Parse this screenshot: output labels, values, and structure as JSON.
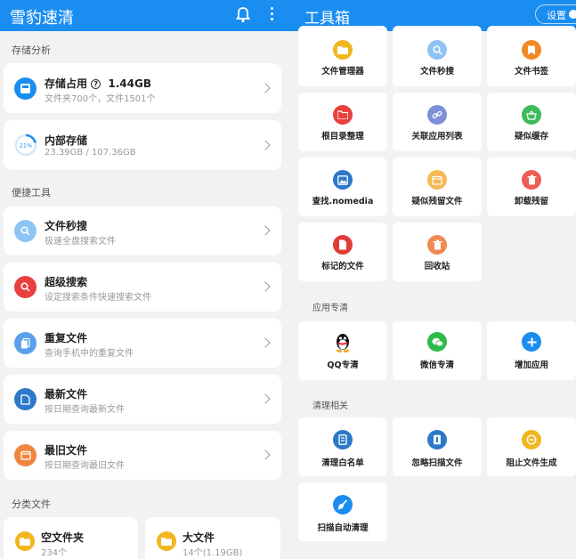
{
  "left_header": {
    "title": "雪豹速清"
  },
  "storage_section": {
    "label": "存储分析"
  },
  "storage_usage": {
    "title": "存储占用",
    "value": "1.44GB",
    "subtitle": "文件夹700个，文件1501个"
  },
  "internal_storage": {
    "title": "内部存储",
    "subtitle": "23.39GB / 107.36GB",
    "percent_label": "21%",
    "percent": 21
  },
  "tools_section": {
    "label": "便捷工具"
  },
  "tools": [
    {
      "title": "文件秒搜",
      "subtitle": "极速全盘搜索文件",
      "icon": "search-icon",
      "color": "#8ec4f3"
    },
    {
      "title": "超级搜索",
      "subtitle": "设定搜索条件快速搜索文件",
      "icon": "search-plus-icon",
      "color": "#e8403f"
    },
    {
      "title": "重复文件",
      "subtitle": "查询手机中的重复文件",
      "icon": "duplicate-file-icon",
      "color": "#5aa0ea"
    },
    {
      "title": "最新文件",
      "subtitle": "按日期查询最新文件",
      "icon": "new-file-icon",
      "color": "#2d79c9"
    },
    {
      "title": "最旧文件",
      "subtitle": "按日期查询最旧文件",
      "icon": "old-file-icon",
      "color": "#ef8640"
    }
  ],
  "category_section": {
    "label": "分类文件"
  },
  "categories": [
    {
      "title": "空文件夹",
      "subtitle": "234个",
      "icon": "folder-icon"
    },
    {
      "title": "大文件",
      "subtitle": "14个(1.19GB)",
      "icon": "folder-icon"
    }
  ],
  "right_header": {
    "title": "工具箱",
    "settings_label": "设置"
  },
  "toolbox": [
    {
      "label": "文件管理器",
      "icon": "folder-icon",
      "color": "#f2b61e"
    },
    {
      "label": "文件秒搜",
      "icon": "search-icon",
      "color": "#8ec4f3"
    },
    {
      "label": "文件书签",
      "icon": "bookmark-icon",
      "color": "#f08a24"
    },
    {
      "label": "根目录整理",
      "icon": "folder-organize-icon",
      "color": "#e8403f"
    },
    {
      "label": "关联应用列表",
      "icon": "link-icon",
      "color": "#7c8fd8"
    },
    {
      "label": "疑似缓存",
      "icon": "basket-icon",
      "color": "#3dbb5a"
    },
    {
      "label": "查找.nomedia",
      "icon": "image-icon",
      "color": "#2d79c9"
    },
    {
      "label": "疑似残留文件",
      "icon": "residual-file-icon",
      "color": "#f6b955"
    },
    {
      "label": "卸载残留",
      "icon": "trash-icon",
      "color": "#ee5c55"
    },
    {
      "label": "标记的文件",
      "icon": "marked-file-icon",
      "color": "#e03c36"
    },
    {
      "label": "回收站",
      "icon": "trash-icon",
      "color": "#ef8a52"
    }
  ],
  "apps_section": {
    "label": "应用专清"
  },
  "apps": [
    {
      "label": "QQ专清",
      "icon": "qq-penguin-icon"
    },
    {
      "label": "微信专清",
      "icon": "wechat-icon",
      "color": "#2fbb4a"
    },
    {
      "label": "增加应用",
      "icon": "plus-icon",
      "color": "#1a8df0"
    }
  ],
  "cleanup_section": {
    "label": "清理相关"
  },
  "cleanup": [
    {
      "label": "清理白名单",
      "icon": "whitelist-icon",
      "color": "#2d79c9"
    },
    {
      "label": "忽略扫描文件",
      "icon": "ignore-file-icon",
      "color": "#2d79c9"
    },
    {
      "label": "阻止文件生成",
      "icon": "block-icon",
      "color": "#f2b61e"
    },
    {
      "label": "扫描自动清理",
      "icon": "broom-icon",
      "color": "#1a8df0"
    }
  ]
}
